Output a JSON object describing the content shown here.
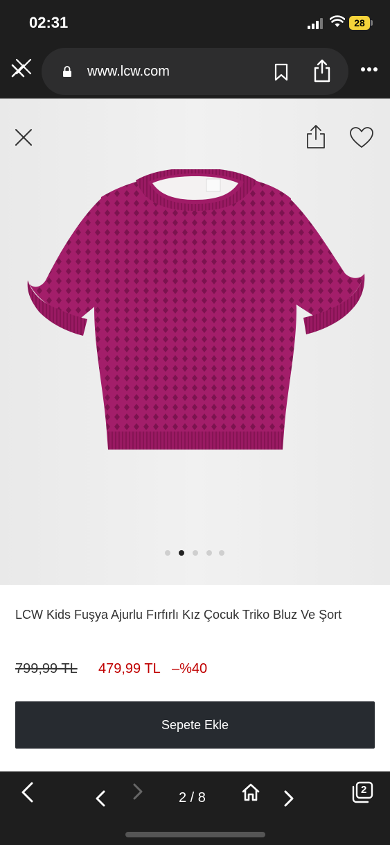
{
  "status_bar": {
    "time": "02:31",
    "battery": "28"
  },
  "browser": {
    "url": "www.lcw.com"
  },
  "carousel": {
    "total_dots": 5,
    "active_dot": 2
  },
  "product": {
    "title": "LCW Kids Fuşya Ajurlu Fırfırlı Kız Çocuk Triko Bluz Ve Şort",
    "old_price": "799,99 TL",
    "new_price": "479,99 TL",
    "discount": "–%40",
    "add_to_cart_label": "Sepete Ekle",
    "color": "#a31e6a"
  },
  "bottom_toolbar": {
    "page_indicator": "2 / 8",
    "tab_count": "2"
  },
  "icons": [
    "close-icon",
    "share-icon",
    "heart-icon",
    "lock-icon",
    "bookmark-icon",
    "more-icon",
    "back-icon",
    "forward-icon",
    "home-icon",
    "tabs-icon"
  ]
}
